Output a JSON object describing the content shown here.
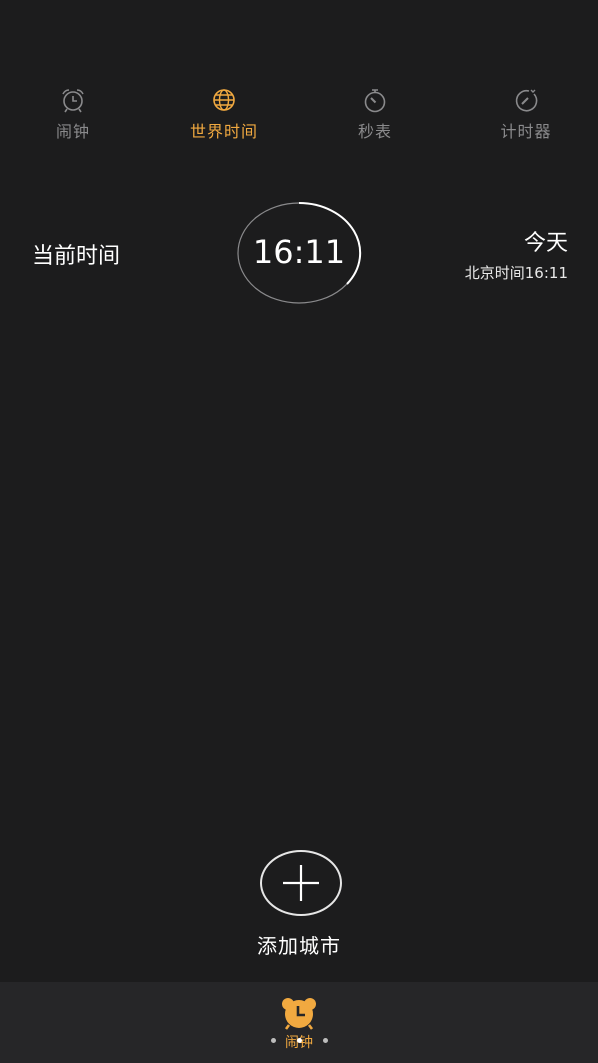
{
  "tabs": [
    {
      "label": "闹钟",
      "icon": "alarm-clock-icon",
      "active": false
    },
    {
      "label": "世界时间",
      "icon": "globe-icon",
      "active": true
    },
    {
      "label": "秒表",
      "icon": "stopwatch-icon",
      "active": false
    },
    {
      "label": "计时器",
      "icon": "timer-icon",
      "active": false
    }
  ],
  "world_clock": {
    "current_label": "当前时间",
    "time": "16:11",
    "day": "今天",
    "zone_time": "北京时间16:11"
  },
  "add_city": {
    "label": "添加城市",
    "icon": "plus-icon"
  },
  "floating": {
    "label": "闹钟",
    "icon": "alarm-clock-filled-icon",
    "page_dots": 3,
    "active_dot": 1
  },
  "colors": {
    "background": "#1c1c1d",
    "accent": "#f1a940",
    "inactive": "#8a8a8c",
    "bottom_bar": "#262628"
  }
}
